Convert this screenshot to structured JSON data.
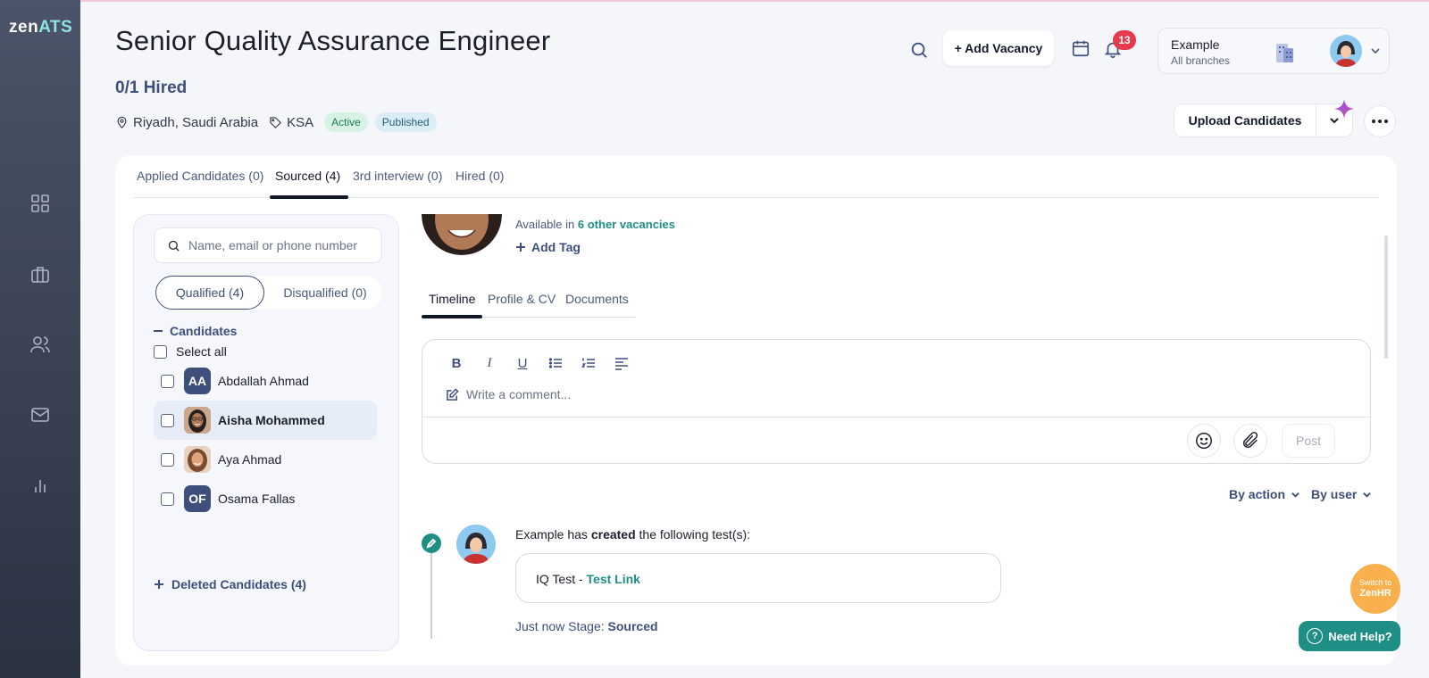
{
  "app": {
    "logo_main": "zen",
    "logo_accent": "ATS"
  },
  "sidebar": {
    "items": [
      {
        "icon": "dashboard-icon"
      },
      {
        "icon": "briefcase-icon"
      },
      {
        "icon": "users-icon"
      },
      {
        "icon": "mail-icon"
      },
      {
        "icon": "bar-chart-icon"
      }
    ]
  },
  "header": {
    "title": "Senior Quality Assurance Engineer",
    "hired": "0/1 Hired",
    "location": "Riyadh, Saudi Arabia",
    "tag": "KSA",
    "status_active": "Active",
    "status_published": "Published",
    "add_vacancy": "+ Add Vacancy",
    "notifications_count": "13",
    "account_name": "Example",
    "account_branch": "All branches",
    "upload_label": "Upload Candidates"
  },
  "tabs": [
    {
      "label": "Applied Candidates (0)"
    },
    {
      "label": "Sourced (4)"
    },
    {
      "label": "3rd interview (0)"
    },
    {
      "label": "Hired (0)"
    }
  ],
  "candidates": {
    "search_placeholder": "Name, email or phone number",
    "qualified": "Qualified (4)",
    "disqualified": "Disqualified (0)",
    "group_label": "Candidates",
    "select_all": "Select all",
    "list": [
      {
        "name": "Abdallah Ahmad",
        "initials": "AA"
      },
      {
        "name": "Aisha Mohammed",
        "initials": ""
      },
      {
        "name": "Aya Ahmad",
        "initials": ""
      },
      {
        "name": "Osama Fallas",
        "initials": "OF"
      }
    ],
    "deleted": "Deleted Candidates (4)"
  },
  "detail": {
    "available_prefix": "Available in",
    "available_link": "6 other vacancies",
    "add_tag": "Add Tag",
    "subtabs": [
      {
        "label": "Timeline"
      },
      {
        "label": "Profile & CV"
      },
      {
        "label": "Documents"
      }
    ],
    "editor": {
      "toolbar": [
        "B",
        "I",
        "U"
      ],
      "placeholder": "Write a comment...",
      "post": "Post"
    },
    "filters": {
      "by_action": "By action",
      "by_user": "By user"
    },
    "timeline": {
      "actor": "Example",
      "verb_pre": " has ",
      "verb": "created",
      "verb_post": " the following test(s):",
      "test_name": "IQ Test - ",
      "test_link": "Test Link",
      "time": "Just now",
      "stage_label": " Stage: ",
      "stage": "Sourced"
    }
  },
  "floating": {
    "switch_small": "Switch to",
    "switch_big": "ZenHR",
    "help": "Need Help?"
  },
  "colors": {
    "accent_teal": "#1f8f86",
    "navy": "#3d4f7a",
    "badge_red": "#e43a4b",
    "switch_orange": "#f7b04b"
  }
}
